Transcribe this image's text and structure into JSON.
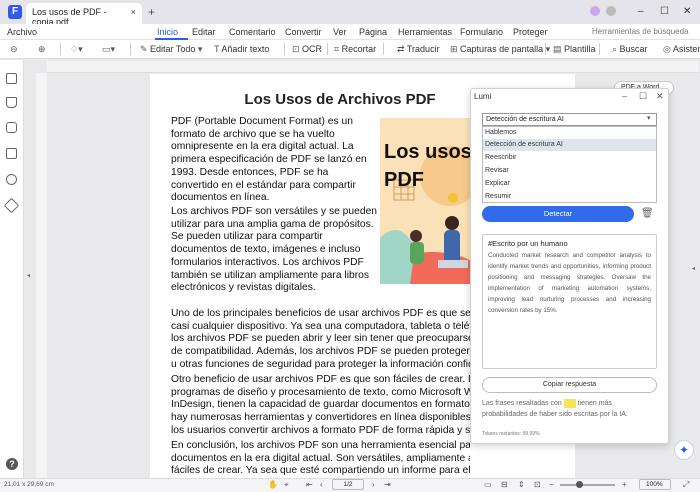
{
  "window": {
    "tab_title": "Los usos de PDF - copia.pdf",
    "tab_close": "×",
    "new_tab": "+",
    "controls": [
      "–",
      "☐",
      "✕"
    ]
  },
  "menubar": {
    "file": "Archivo",
    "items": [
      "Inicio",
      "Editar",
      "Comentario",
      "Convertir",
      "Ver",
      "Página",
      "Herramientas",
      "Formulario",
      "Proteger"
    ],
    "active": "Inicio",
    "search_placeholder": "Herramientas de búsqueda"
  },
  "toolbar": {
    "edit_all": "Editar Todo",
    "add_text": "Añadir texto",
    "ocr": "OCR",
    "crop": "Recortar",
    "translate": "Traducir",
    "screenshots": "Capturas de pantalla",
    "template": "Plantilla",
    "search": "Buscar",
    "assistant": "Asistente"
  },
  "document": {
    "heading": "Los Usos de Archivos PDF",
    "para1": "PDF (Portable Document Format) es un\nformato de archivo que se ha vuelto\nomnipresente en la era digital actual. La\nprimera especificación de PDF se lanzó en\n1993. Desde entonces, PDF se ha\nconvertido en el estándar para compartir\ndocumentos en línea.",
    "para2": "Los archivos PDF son versátiles y se pueden\nutilizar para una amplia gama de propósitos.\nSe pueden utilizar para compartir\ndocumentos de texto, imágenes e incluso\nformularios interactivos. Los archivos PDF\ntambién se utilizan ampliamente para libros\nelectrónicos y revistas digitales.",
    "para3": "Uno de los principales beneficios de usar archivos PDF es que se pueden abrir en\ncasi cualquier dispositivo. Ya sea una computadora, tableta o teléfono inteligente,\nlos archivos PDF se pueden abrir y leer sin tener que preocuparse por problemas\nde compatibilidad. Además, los archivos PDF se pueden proteger con contraseña\nu otras funciones de seguridad para proteger la información confidencial.",
    "para4": "Otro beneficio de usar archivos PDF es que son fáciles de crear. La mayoría de los\nprogramas de diseño y procesamiento de texto, como Microsoft Word o Adobe\nInDesign, tienen la capacidad de guardar documentos en formato PDF. Además,\nhay numerosas herramientas y convertidores en línea disponibles que permiten a\nlos usuarios convertir archivos a formato PDF de forma rápida y sencilla.",
    "para5": "En conclusión, los archivos PDF son una herramienta esencial para compartir\ndocumentos en la era digital actual. Son versátiles, ampliamente accesibles y\nfáciles de crear. Ya sea que esté compartiendo un informe para el trabajo o",
    "hero_text": "Los usos\nPDF",
    "pdf_pill": "PDF a Word"
  },
  "lumi": {
    "title": "Lumi",
    "selected": "Detección de escritura AI",
    "options": [
      "Hablemos",
      "Detección de escritura AI",
      "Reescribir",
      "Revisar",
      "Explicar",
      "Resumir"
    ],
    "detect_button": "Detectar",
    "result_title": "#Escrito por un humano",
    "result_body": "Conducted market research and competitor analysis to identify market trends and opportunities, informing product positioning and messaging strategies. Oversaw the implementation of marketing automation systems, improving lead nurturing processes and increasing conversion rates by 15%.",
    "copy_button": "Copiar respuesta",
    "result_line_a": "Las frases resaltadas con",
    "result_line_b": "tienen más probabilidades de haber sido escritas por la IA.",
    "tokens": "Tokens restantes: 99.99%"
  },
  "statusbar": {
    "dimensions": "21,01 x 29,69 cm",
    "page": "1/2",
    "zoom": "100%"
  },
  "colors": {
    "accent": "#2f5bea",
    "highlight_yellow": "#f8e45a"
  }
}
